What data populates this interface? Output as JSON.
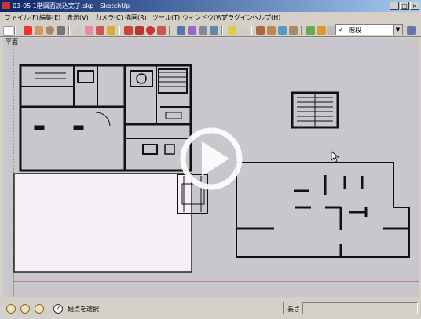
{
  "window": {
    "title": "03-05  1階図面読込完了.skp - SketchUp",
    "minimize": "_",
    "maximize": "□",
    "close": "×"
  },
  "menu": {
    "items": [
      "ファイル(F)",
      "編集(E)",
      "表示(V)",
      "カメラ(C)",
      "描画(R)",
      "ツール(T)",
      "ウィンドウ(W)",
      "プラグイン",
      "ヘルプ(H)"
    ]
  },
  "toolbar": {
    "layer_check": "✓",
    "layer_value": "階段",
    "layer_arrow": "▼"
  },
  "scene": {
    "label": "平面"
  },
  "statusbar": {
    "help": "?",
    "status_text": "始点を選択",
    "measure_label": "長さ"
  },
  "colors": {
    "viewport_bg": "#c9c6ce",
    "selected_rect_fill": "#f5f0f6",
    "play_overlay": "#ffffff",
    "axis_red": "#cc3333",
    "axis_green": "#3a8a3a"
  }
}
